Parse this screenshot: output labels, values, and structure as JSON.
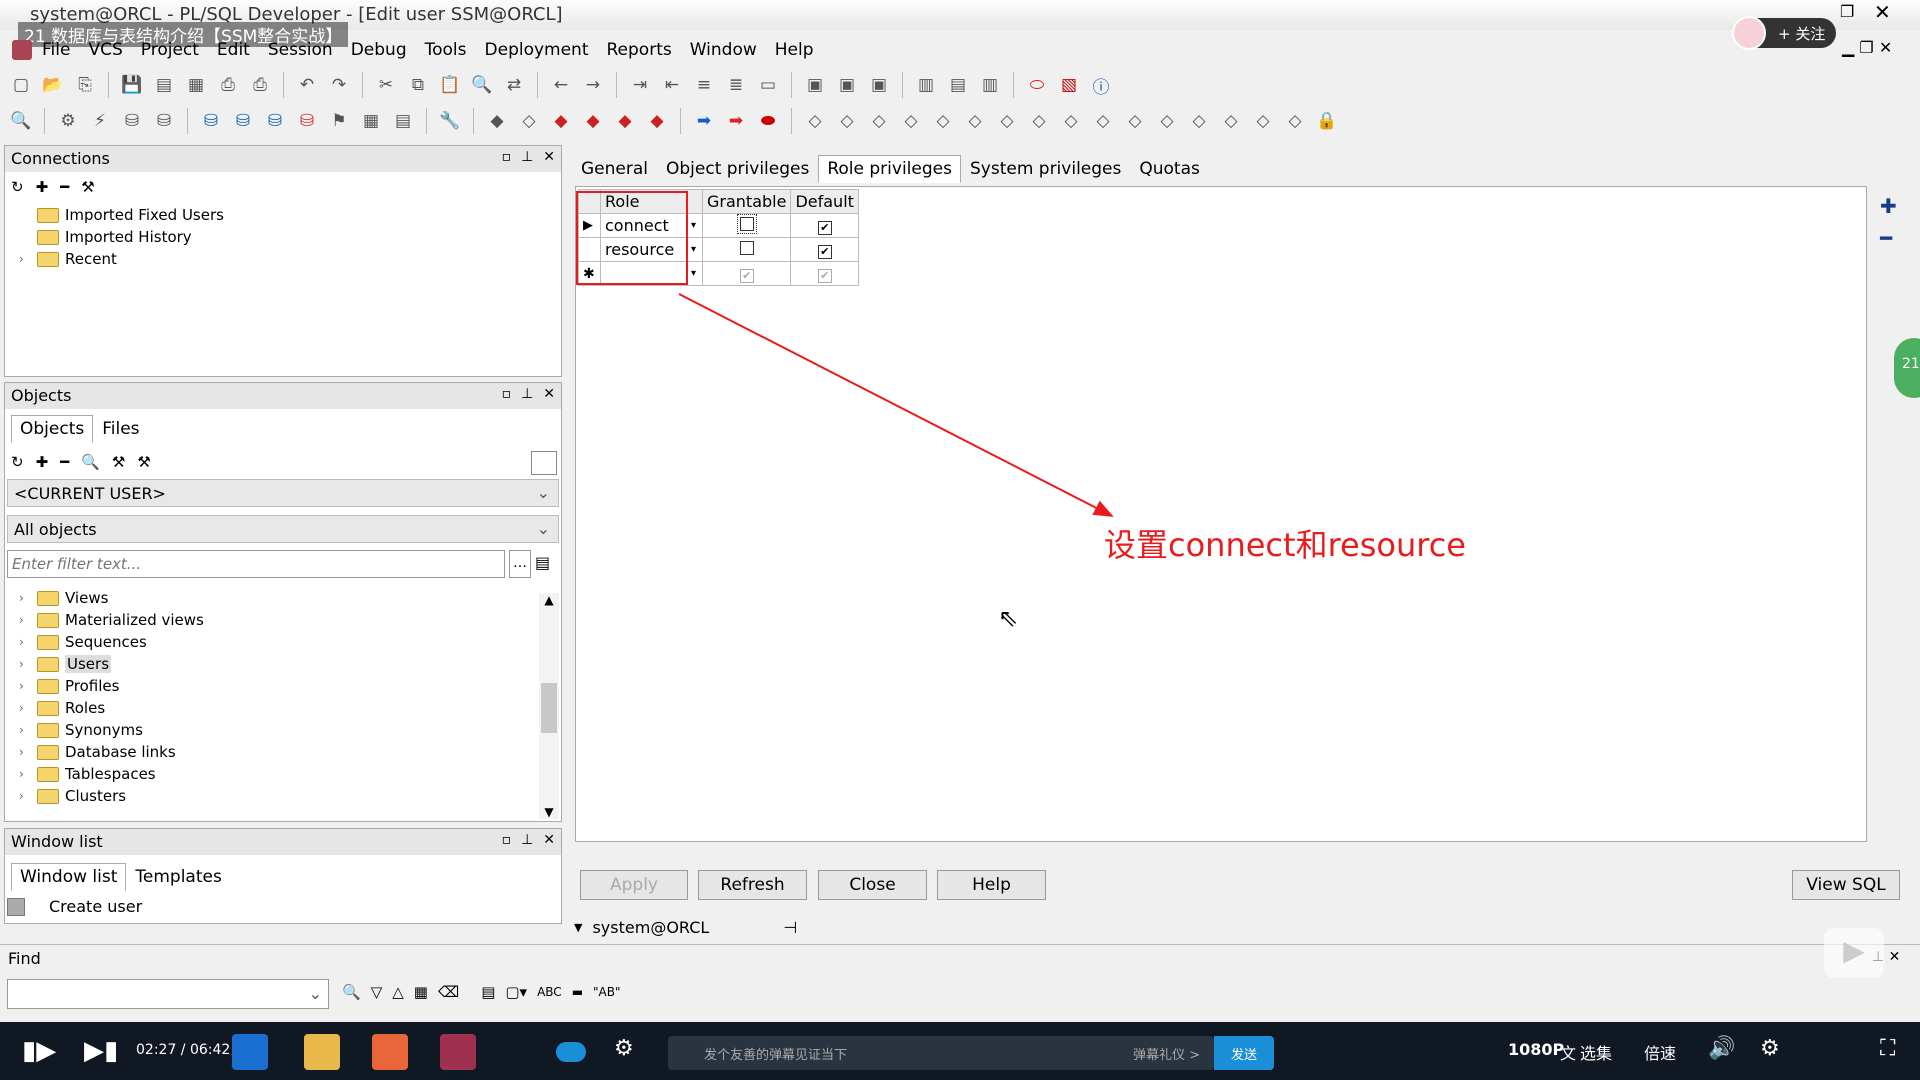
{
  "window": {
    "title": "system@ORCL - PL/SQL Developer - [Edit user SSM@ORCL]",
    "overlay_title": "21 数据库与表结构介绍【SSM整合实战】",
    "follow_label": "+ 关注"
  },
  "menu": [
    "File",
    "VCS",
    "Project",
    "Edit",
    "Session",
    "Debug",
    "Tools",
    "Deployment",
    "Reports",
    "Window",
    "Help"
  ],
  "connections": {
    "title": "Connections",
    "items": [
      "Imported Fixed Users",
      "Imported History",
      "Recent"
    ]
  },
  "objects": {
    "title": "Objects",
    "tabs": [
      "Objects",
      "Files"
    ],
    "user_combo": "<CURRENT USER>",
    "filter_combo": "All objects",
    "filter_placeholder": "Enter filter text...",
    "tree": [
      "Views",
      "Materialized views",
      "Sequences",
      "Users",
      "Profiles",
      "Roles",
      "Synonyms",
      "Database links",
      "Tablespaces",
      "Clusters"
    ]
  },
  "window_list": {
    "title": "Window list",
    "tabs": [
      "Window list",
      "Templates"
    ],
    "items": [
      "Create user"
    ]
  },
  "editor": {
    "tabs": [
      "General",
      "Object privileges",
      "Role privileges",
      "System privileges",
      "Quotas"
    ],
    "active_tab": "Role privileges",
    "grid_headers": [
      "Role",
      "Grantable",
      "Default"
    ],
    "rows": [
      {
        "role": "connect",
        "grantable": false,
        "default": true
      },
      {
        "role": "resource",
        "grantable": false,
        "default": true
      }
    ],
    "annotation": "设置connect和resource",
    "buttons": {
      "apply": "Apply",
      "refresh": "Refresh",
      "close": "Close",
      "help": "Help",
      "view_sql": "View SQL"
    },
    "connection_label": "system@ORCL"
  },
  "find": {
    "title": "Find",
    "tools": [
      "ABC",
      "\"AB\""
    ]
  },
  "taskbar": {
    "time": "02:27 / 06:42",
    "danmaku_placeholder": "发个友善的弹幕见证当下",
    "danmaku_gift": "弹幕礼仪 >",
    "send": "发送",
    "quality": "1080P",
    "subtitle": "文",
    "episodes": "选集",
    "speed": "倍速",
    "badge": "21"
  },
  "colors": {
    "annotation": "#e81c1c",
    "send_button": "#1a8fd8"
  }
}
